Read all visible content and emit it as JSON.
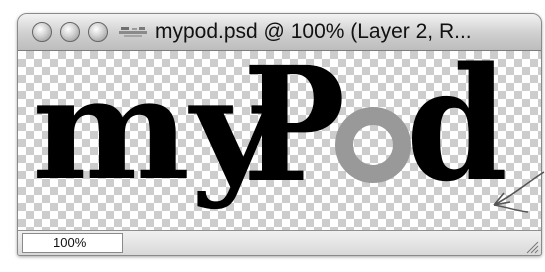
{
  "window": {
    "title": "mypod.psd @ 100% (Layer 2, R..."
  },
  "canvas": {
    "logo": {
      "text_my": "my",
      "text_p": "P",
      "text_d": "d",
      "o_color": "#999999"
    }
  },
  "status": {
    "zoom": "100%"
  },
  "icons": {
    "close": "close-button-icon",
    "minimize": "minimize-button-icon",
    "zoom": "zoom-button-icon",
    "document": "document-proxy-icon",
    "resize": "resize-grip-icon",
    "annotation": "annotation-arrow-icon"
  }
}
